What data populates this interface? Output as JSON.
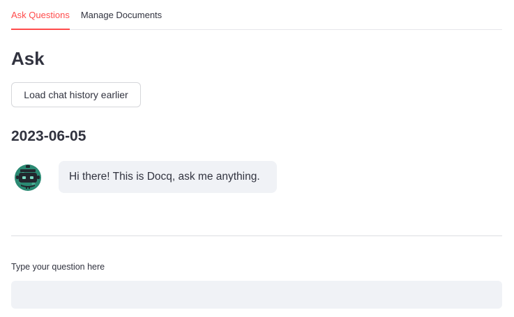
{
  "tabs": [
    {
      "label": "Ask Questions",
      "active": true
    },
    {
      "label": "Manage Documents",
      "active": false
    }
  ],
  "page_title": "Ask",
  "load_history_button": "Load chat history earlier",
  "chat": {
    "date": "2023-06-05",
    "messages": [
      {
        "sender": "bot",
        "avatar": "robot-avatar-icon",
        "text": "Hi there! This is Docq, ask me anything."
      }
    ]
  },
  "question": {
    "label": "Type your question here",
    "value": "",
    "placeholder": ""
  },
  "colors": {
    "accent": "#ff4b4b",
    "text": "#31333f",
    "bubble_bg": "#f0f2f6",
    "input_bg": "#f0f2f6",
    "avatar": "#2b8a73"
  }
}
